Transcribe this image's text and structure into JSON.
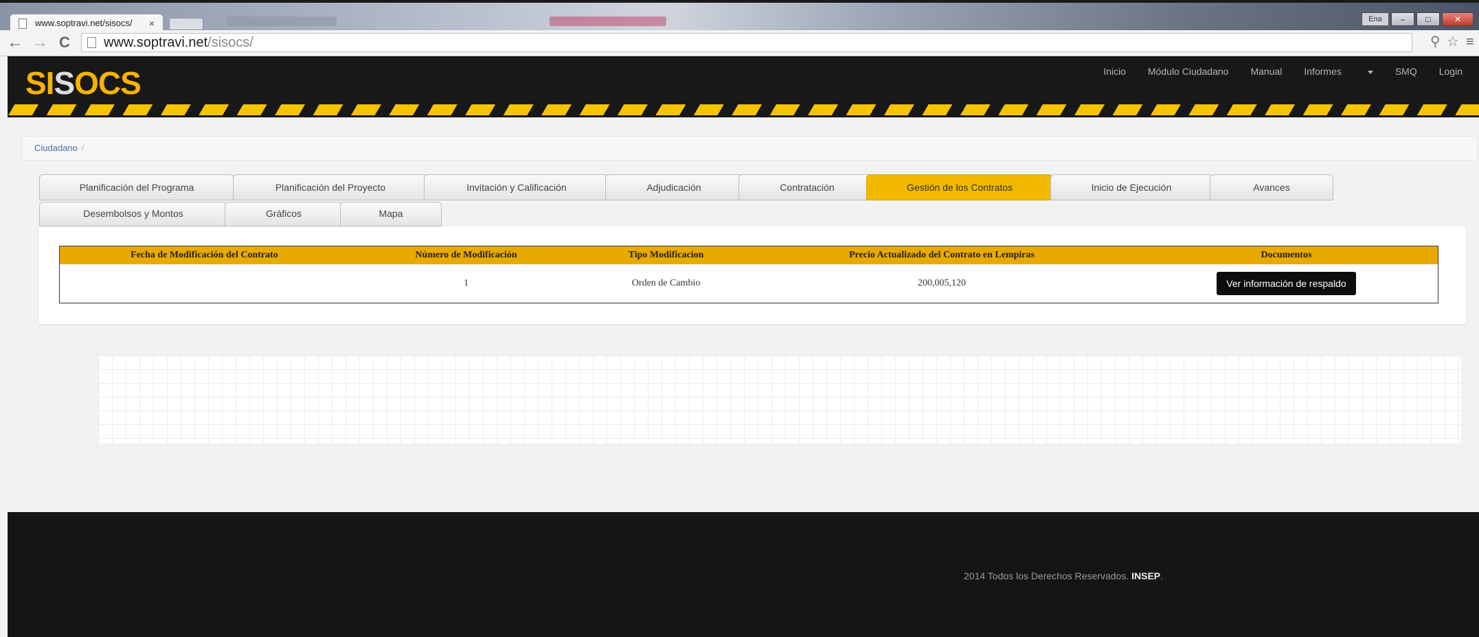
{
  "browser": {
    "tab_title": "www.soptravi.net/sisocs/",
    "tab_close": "×",
    "url_host": "www.soptravi.net",
    "url_path": "/sisocs/",
    "lang_indicator": "Ena",
    "back_glyph": "←",
    "forward_glyph": "→",
    "reload_glyph": "C",
    "star_glyph": "☆",
    "menu_glyph": "≡",
    "ext_glyph": "⚲",
    "minimize_glyph": "–",
    "maximize_glyph": "□",
    "close_glyph": "✕"
  },
  "site": {
    "logo": {
      "left": "SI",
      "mid": "S",
      "right": "OCS"
    },
    "nav": {
      "inicio": "Inicio",
      "modulo_ciudadano": "Módulo Ciudadano",
      "manual": "Manual",
      "informes": "Informes",
      "smq": "SMQ",
      "login": "Login"
    },
    "breadcrumb": {
      "link": "Ciudadano",
      "separator": "/"
    },
    "tabs": {
      "row1": [
        "Planificación del Programa",
        "Planificación del Proyecto",
        "Invitación y Calificación",
        "Adjudicación",
        "Contratación",
        "Gestión de los Contratos",
        "Inicio de Ejecución",
        "Avances"
      ],
      "row2": [
        "Desembolsos y Montos",
        "Gráficos",
        "Mapa"
      ],
      "active": "Gestión de los Contratos"
    },
    "table": {
      "headers": [
        "Fecha de Modificación del Contrato",
        "Número de Modificación",
        "Tipo Modificacion",
        "Precio Actualizado del Contrato en Lempiras",
        "Documentos"
      ],
      "rows": [
        {
          "fecha": "",
          "numero": "1",
          "tipo": "Orden de Cambio",
          "precio": "200,005,120",
          "documentos_button": "Ver información de respaldo"
        }
      ]
    },
    "footer": {
      "text": "2014 Todos los Derechos Reservados.",
      "brand": "INSEP",
      "end": "."
    }
  },
  "colors": {
    "accent": "#f2b900",
    "table_header": "#e9aa00",
    "header_bg": "#181818",
    "link": "#3d6fb0"
  }
}
